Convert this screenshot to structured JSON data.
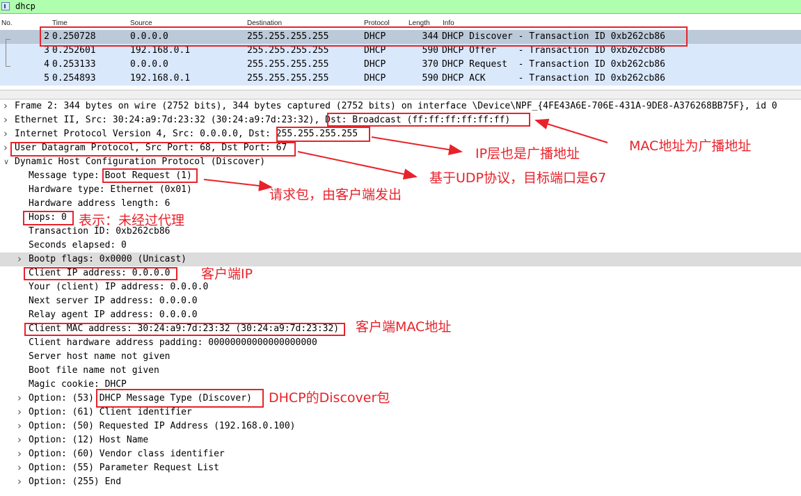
{
  "filter": {
    "value": "dhcp"
  },
  "columns": [
    "No.",
    "Time",
    "Source",
    "Destination",
    "Protocol",
    "Length",
    "Info"
  ],
  "packets": [
    {
      "no": "2",
      "time": "0.250728",
      "src": "0.0.0.0",
      "dst": "255.255.255.255",
      "proto": "DHCP",
      "len": "344",
      "info": "DHCP Discover - Transaction ID 0xb262cb86"
    },
    {
      "no": "3",
      "time": "0.252601",
      "src": "192.168.0.1",
      "dst": "255.255.255.255",
      "proto": "DHCP",
      "len": "590",
      "info": "DHCP Offer    - Transaction ID 0xb262cb86"
    },
    {
      "no": "4",
      "time": "0.253133",
      "src": "0.0.0.0",
      "dst": "255.255.255.255",
      "proto": "DHCP",
      "len": "370",
      "info": "DHCP Request  - Transaction ID 0xb262cb86"
    },
    {
      "no": "5",
      "time": "0.254893",
      "src": "192.168.0.1",
      "dst": "255.255.255.255",
      "proto": "DHCP",
      "len": "590",
      "info": "DHCP ACK      - Transaction ID 0xb262cb86"
    }
  ],
  "details": [
    {
      "text": "Frame 2: 344 bytes on wire (2752 bits), 344 bytes captured (2752 bits) on interface \\Device\\NPF_{4FE43A6E-706E-431A-9DE8-A376268BB75F}, id 0",
      "arrow": "collapsed"
    },
    {
      "text": "Ethernet II, Src: 30:24:a9:7d:23:32 (30:24:a9:7d:23:32), Dst: Broadcast (ff:ff:ff:ff:ff:ff)",
      "arrow": "collapsed"
    },
    {
      "text": "Internet Protocol Version 4, Src: 0.0.0.0, Dst: 255.255.255.255",
      "arrow": "collapsed"
    },
    {
      "text": "User Datagram Protocol, Src Port: 68, Dst Port: 67",
      "arrow": "collapsed"
    },
    {
      "text": "Dynamic Host Configuration Protocol (Discover)",
      "arrow": "expanded"
    },
    {
      "text": "Message type: Boot Request (1)",
      "arrow": "none"
    },
    {
      "text": "Hardware type: Ethernet (0x01)",
      "arrow": "none"
    },
    {
      "text": "Hardware address length: 6",
      "arrow": "none"
    },
    {
      "text": "Hops: 0",
      "arrow": "none"
    },
    {
      "text": "Transaction ID: 0xb262cb86",
      "arrow": "none"
    },
    {
      "text": "Seconds elapsed: 0",
      "arrow": "none"
    },
    {
      "text": "Bootp flags: 0x0000 (Unicast)",
      "arrow": "collapsed"
    },
    {
      "text": "Client IP address: 0.0.0.0",
      "arrow": "none"
    },
    {
      "text": "Your (client) IP address: 0.0.0.0",
      "arrow": "none"
    },
    {
      "text": "Next server IP address: 0.0.0.0",
      "arrow": "none"
    },
    {
      "text": "Relay agent IP address: 0.0.0.0",
      "arrow": "none"
    },
    {
      "text": "Client MAC address: 30:24:a9:7d:23:32 (30:24:a9:7d:23:32)",
      "arrow": "none"
    },
    {
      "text": "Client hardware address padding: 00000000000000000000",
      "arrow": "none"
    },
    {
      "text": "Server host name not given",
      "arrow": "none"
    },
    {
      "text": "Boot file name not given",
      "arrow": "none"
    },
    {
      "text": "Magic cookie: DHCP",
      "arrow": "none"
    },
    {
      "text": "Option: (53) DHCP Message Type (Discover)",
      "arrow": "collapsed"
    },
    {
      "text": "Option: (61) Client identifier",
      "arrow": "collapsed"
    },
    {
      "text": "Option: (50) Requested IP Address (192.168.0.100)",
      "arrow": "collapsed"
    },
    {
      "text": "Option: (12) Host Name",
      "arrow": "collapsed"
    },
    {
      "text": "Option: (60) Vendor class identifier",
      "arrow": "collapsed"
    },
    {
      "text": "Option: (55) Parameter Request List",
      "arrow": "collapsed"
    },
    {
      "text": "Option: (255) End",
      "arrow": "collapsed"
    }
  ],
  "annotations": {
    "mac_broadcast": "MAC地址为广播地址",
    "ip_broadcast": "IP层也是广播地址",
    "udp_port": "基于UDP协议，目标端口是67",
    "request": "请求包，由客户端发出",
    "hops": "表示：未经过代理",
    "client_ip": "客户端IP",
    "client_mac": "客户端MAC地址",
    "discover": "DHCP的Discover包"
  },
  "colors": {
    "accent": "#e8222a",
    "selected_row": "#bcc9d8",
    "row_bg": "#dae8fb",
    "filter_bg": "#afffaf"
  }
}
